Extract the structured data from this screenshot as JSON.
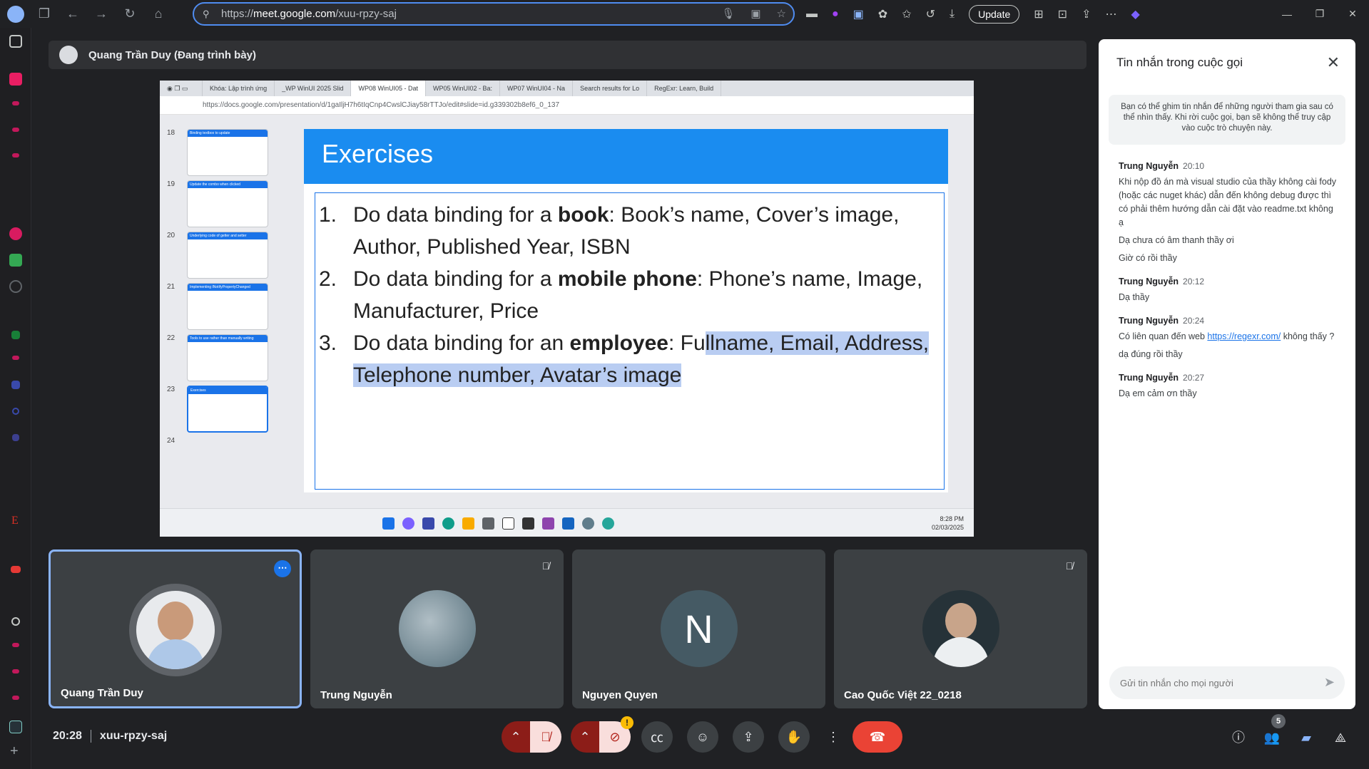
{
  "browser": {
    "url_prefix": "https://",
    "url_host": "meet.google.com",
    "url_path": "/xuu-rpzy-saj",
    "update_label": "Update"
  },
  "presenter": {
    "name": "Quang Trần Duy (Đang trình bày)"
  },
  "shared_screen": {
    "tabs": [
      "Khóa: Lập trình ứng",
      "_WP WinUI 2025 Slid",
      "WP08 WinUI05 - Dat",
      "WP05 WinUI02 - Ba:",
      "WP07 WinUI04 - Na",
      "Search results for Lo",
      "RegExr: Learn, Build"
    ],
    "active_tab_index": 2,
    "address": "https://docs.google.com/presentation/d/1gaIljH7h6tIqCnp4CwslCJiay58rTTJo/edit#slide=id.g339302b8ef6_0_137",
    "thumbnails": [
      {
        "num": "18",
        "title": "Binding textbox to update"
      },
      {
        "num": "19",
        "title": "Update the combo when clicked"
      },
      {
        "num": "20",
        "title": "Underlying code of getter and setter"
      },
      {
        "num": "21",
        "title": "Implementing INotifyPropertyChanged"
      },
      {
        "num": "22",
        "title": "Tools to use rather than manually writing"
      },
      {
        "num": "23",
        "title": "Exercises"
      },
      {
        "num": "24",
        "title": ""
      }
    ],
    "slide": {
      "title": "Exercises",
      "items": [
        {
          "num": "1.",
          "pre": "Do data binding for a ",
          "bold": "book",
          "post": ": Book’s name, Cover’s image, Author, Published Year, ISBN",
          "post_hl": ""
        },
        {
          "num": "2.",
          "pre": "Do data binding for a ",
          "bold": "mobile phone",
          "post": ": Phone’s name, Image, Manufacturer, Price",
          "post_hl": ""
        },
        {
          "num": "3.",
          "pre": "Do data binding for an ",
          "bold": "employee",
          "post": ": Fu",
          "post_hl": "llname, Email, Address, Telephone number, Avatar’s image"
        }
      ]
    },
    "taskbar_time": "8:28 PM",
    "taskbar_date": "02/03/2025"
  },
  "participants": [
    {
      "name": "Quang Trần Duy",
      "active": true
    },
    {
      "name": "Trung Nguyễn",
      "muted": true
    },
    {
      "name": "Nguyen Quyen",
      "initial": "N"
    },
    {
      "name": "Cao Quốc Việt 22_0218",
      "muted": true
    }
  ],
  "meeting": {
    "time": "20:28",
    "code": "xuu-rpzy-saj",
    "participant_count": "5",
    "warning": "!"
  },
  "chat": {
    "title": "Tin nhắn trong cuộc gọi",
    "note": "Bạn có thể ghim tin nhắn để những người tham gia sau có thể nhìn thấy. Khi rời cuộc gọi, bạn sẽ không thể truy cập vào cuộc trò chuyện này.",
    "messages": [
      {
        "sender": "Trung Nguyễn",
        "time": "20:10",
        "lines": [
          "Khi nộp đồ án mà visual studio của thầy không cài fody (hoặc các nuget khác) dẫn đến không debug được thì có  phải thêm hướng dẫn cài đặt vào readme.txt không ạ",
          "Dạ chưa có âm thanh thầy ơi",
          "Giờ có rồi thầy"
        ]
      },
      {
        "sender": "Trung Nguyễn",
        "time": "20:12",
        "lines": [
          "Dạ thầy"
        ]
      },
      {
        "sender": "Trung Nguyễn",
        "time": "20:24",
        "link_pre": "Có liên quan đến web ",
        "link": "https://regexr.com/",
        "link_post": " không thấy ?",
        "lines": [
          "dạ đúng rồi thầy"
        ]
      },
      {
        "sender": "Trung Nguyễn",
        "time": "20:27",
        "lines": [
          "Dạ em cảm ơn thầy"
        ]
      }
    ],
    "input_placeholder": "Gửi tin nhắn cho mọi người"
  },
  "colors": {
    "accent": "#8ab4f8",
    "end_call": "#ea4335",
    "slide_title_bar": "#1a8cf0",
    "selection": "#b9cdf2"
  }
}
